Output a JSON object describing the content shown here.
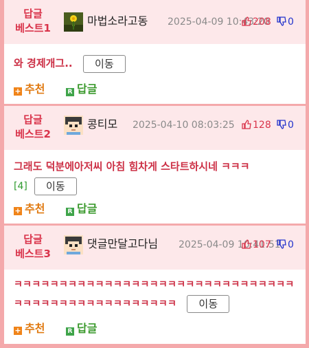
{
  "comments": [
    {
      "badge": "답글\n베스트1",
      "badge_line1": "답글",
      "badge_line2": "베스트1",
      "avatar": "flower-avatar",
      "nickname": "마법소라고동",
      "date": "2025-04-09 10:43:20",
      "likes": "208",
      "dislikes": "0",
      "content": "와 경제개그..",
      "reply_count": "",
      "move_label": "이동",
      "recommend_label": "추천",
      "reply_label": "답글"
    },
    {
      "badge_line1": "답글",
      "badge_line2": "베스트2",
      "avatar": "pixel-face-avatar",
      "nickname": "콩티모",
      "date": "2025-04-10 08:03:25",
      "likes": "128",
      "dislikes": "0",
      "content": "그래도 덕분에아저씨 아침 힘차게 스타트하시네 ㅋㅋㅋ",
      "reply_count": "[4]",
      "move_label": "이동",
      "recommend_label": "추천",
      "reply_label": "답글"
    },
    {
      "badge_line1": "답글",
      "badge_line2": "베스트3",
      "avatar": "pixel-face-avatar",
      "nickname": "댓글만달고다님",
      "date": "2025-04-09 10:41:51",
      "likes": "107",
      "dislikes": "0",
      "content": "ㅋㅋㅋㅋㅋㅋㅋㅋㅋㅋㅋㅋㅋㅋㅋㅋㅋㅋㅋㅋㅋㅋㅋㅋㅋㅋㅋㅋㅋㅋㅋㅋㅋㅋㅋㅋㅋㅋㅋㅋㅋㅋㅋㅋㅋㅋㅋㅋㅋ",
      "reply_count": "",
      "move_label": "이동",
      "recommend_label": "추천",
      "reply_label": "답글"
    }
  ],
  "colors": {
    "page_border": "#f4a9ab",
    "header_bg": "#fde8ea",
    "accent_red": "#d9334a",
    "dislike_blue": "#2233cc",
    "recommend_orange": "#e07a12",
    "reply_green": "#3c9a2e"
  }
}
